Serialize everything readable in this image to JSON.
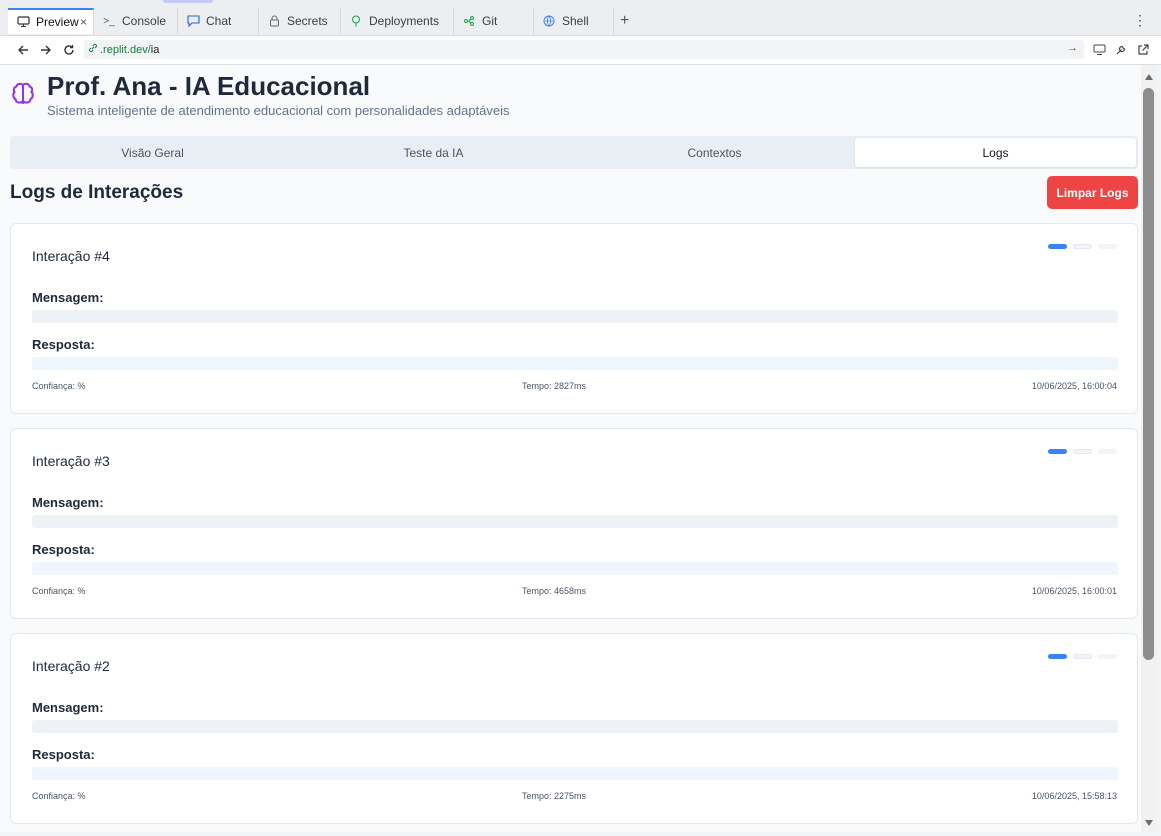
{
  "browser": {
    "tabs": [
      {
        "label": "Preview",
        "icon": "monitor-icon",
        "active": true
      },
      {
        "label": "Console",
        "icon": "terminal-icon"
      },
      {
        "label": "Chat",
        "icon": "chat-icon"
      },
      {
        "label": "Secrets",
        "icon": "lock-icon"
      },
      {
        "label": "Deployments",
        "icon": "deploy-icon"
      },
      {
        "label": "Git",
        "icon": "git-icon"
      },
      {
        "label": "Shell",
        "icon": "shell-icon"
      }
    ],
    "url_host": ".replit.dev/",
    "url_path": "ia"
  },
  "app": {
    "title": "Prof. Ana - IA Educacional",
    "subtitle": "Sistema inteligente de atendimento educacional com personalidades adaptáveis",
    "nav_tabs": [
      "Visão Geral",
      "Teste da IA",
      "Contextos",
      "Logs"
    ],
    "selected_tab": "Logs"
  },
  "logs": {
    "title": "Logs de Interações",
    "clear_label": "Limpar Logs",
    "message_label": "Mensagem:",
    "response_label": "Resposta:",
    "items": [
      {
        "title": "Interação #4",
        "confidence": "Confiança: %",
        "time": "Tempo: 2827ms",
        "date": "10/06/2025, 16:00:04"
      },
      {
        "title": "Interação #3",
        "confidence": "Confiança: %",
        "time": "Tempo: 4658ms",
        "date": "10/06/2025, 16:00:01"
      },
      {
        "title": "Interação #2",
        "confidence": "Confiança: %",
        "time": "Tempo: 2275ms",
        "date": "10/06/2025, 15:58:13"
      }
    ]
  },
  "colors": {
    "accent": "#3b82f6",
    "danger": "#ef4444",
    "brain_icon": "#9333ea"
  }
}
